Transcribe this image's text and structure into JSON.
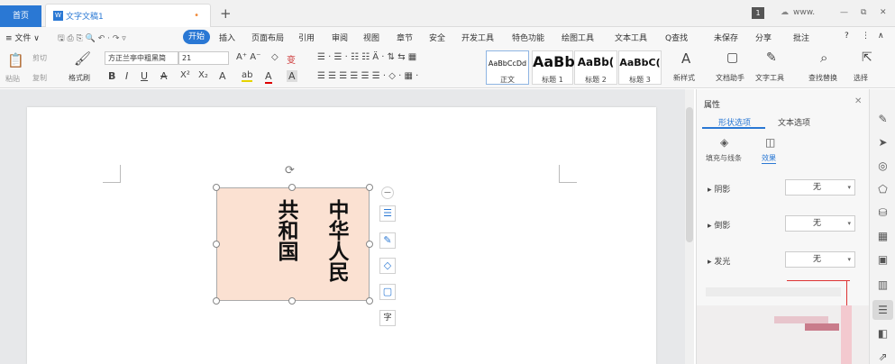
{
  "titlebar": {
    "home_tab": "首页",
    "doc_icon": "W",
    "doc_title": "文字文稿1",
    "unsaved_dot": "•",
    "new_tab": "+",
    "page_badge": "1",
    "account": "www.",
    "minimize": "—",
    "restore": "⧉",
    "close": "✕"
  },
  "menu": {
    "file": "≡ 文件 ∨",
    "quick_icons": "🖫 ⎙ ⎘ 🔍 ↶ · ↷ ▿",
    "start": "开始",
    "items": [
      "插入",
      "页面布局",
      "引用",
      "审阅",
      "视图",
      "章节",
      "安全",
      "开发工具",
      "特色功能",
      "绘图工具",
      "文本工具"
    ],
    "search": "Q查找",
    "unsaved": "未保存",
    "share": "分享",
    "comment": "批注",
    "help": "?",
    "more": "⋮",
    "collapse": "∧"
  },
  "ribbon": {
    "paste": "粘贴",
    "cut": "剪切",
    "copy": "复制",
    "format_painter": "格式刷",
    "font_name": "方正兰亭中粗黑简",
    "font_size": "21",
    "grow_font": "A⁺ A⁻",
    "clear_format": "◇",
    "pinyin": "变",
    "bold": "B",
    "italic": "I",
    "underline": "U",
    "strike": "A",
    "superscript": "X²",
    "subscript": "X₂",
    "font_color": "A",
    "highlight": "ab",
    "char_shade": "A",
    "char_border": "A",
    "list_row1": "☰ · ☰ · ☷ ☷ Ä · ⇅ ⇆ ▦",
    "list_row2": "☰ ☰ ☰ ☰ ☰ ☰ · ◇ · ▦ ·",
    "styles": [
      {
        "sample": "AaBbCcDd",
        "label": "正文"
      },
      {
        "sample": "AaBb",
        "label": "标题 1"
      },
      {
        "sample": "AaBb(",
        "label": "标题 2"
      },
      {
        "sample": "AaBbC(",
        "label": "标题 3"
      }
    ],
    "new_style": "新样式",
    "doc_helper": "文档助手",
    "text_tools": "文字工具",
    "find_replace": "查找替换",
    "select": "选择"
  },
  "document": {
    "textbox_col1": "中华人民",
    "textbox_col2": "共和国",
    "rotate_icon": "⟳"
  },
  "panel": {
    "title": "属性",
    "tab_shape": "形状选项",
    "tab_text": "文本选项",
    "sub_fill": "填充与线条",
    "sub_effect": "效果",
    "rows": [
      {
        "label": "阴影",
        "value": "无"
      },
      {
        "label": "倒影",
        "value": "无"
      },
      {
        "label": "发光",
        "value": "无"
      }
    ]
  },
  "colors": {
    "accent": "#2a78d4",
    "textbox_fill": "#fbe1d2"
  }
}
